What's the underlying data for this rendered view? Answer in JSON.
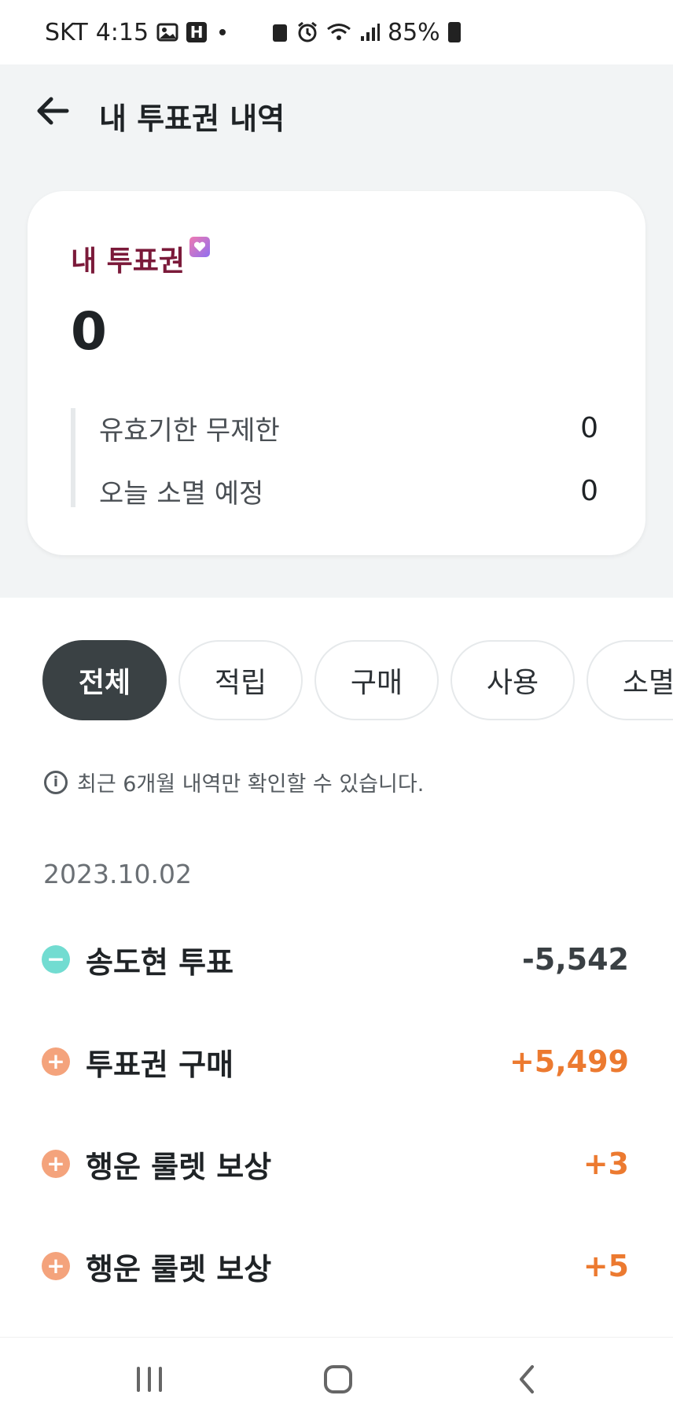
{
  "status_bar": {
    "carrier": "SKT",
    "time": "4:15",
    "battery": "85%",
    "icons": [
      "image-icon",
      "h-badge-icon",
      "dot-icon",
      "recycle-icon",
      "alarm-icon",
      "wifi-icon",
      "signal-icon",
      "battery-icon"
    ]
  },
  "header": {
    "title": "내 투표권 내역",
    "back_icon": "arrow-left-icon"
  },
  "summary": {
    "label": "내 투표권",
    "total": "0",
    "rows": [
      {
        "label": "유효기한 무제한",
        "value": "0"
      },
      {
        "label": "오늘 소멸 예정",
        "value": "0"
      }
    ]
  },
  "filters": [
    "전체",
    "적립",
    "구매",
    "사용",
    "소멸"
  ],
  "active_filter": "전체",
  "notice": "최근 6개월 내역만 확인할 수 있습니다.",
  "history": {
    "date": "2023.10.02",
    "items": [
      {
        "type": "minus",
        "title": "송도현 투표",
        "amount": "-5,542"
      },
      {
        "type": "plus",
        "title": "투표권 구매",
        "amount": "+5,499"
      },
      {
        "type": "plus",
        "title": "행운 룰렛 보상",
        "amount": "+3"
      },
      {
        "type": "plus",
        "title": "행운 룰렛 보상",
        "amount": "+5"
      }
    ]
  },
  "colors": {
    "accent_orange": "#ec7a30",
    "minus_teal": "#72dcd1",
    "plus_orange": "#f4a37c",
    "label_wine": "#7b1a3a",
    "chip_active": "#3a4144"
  }
}
